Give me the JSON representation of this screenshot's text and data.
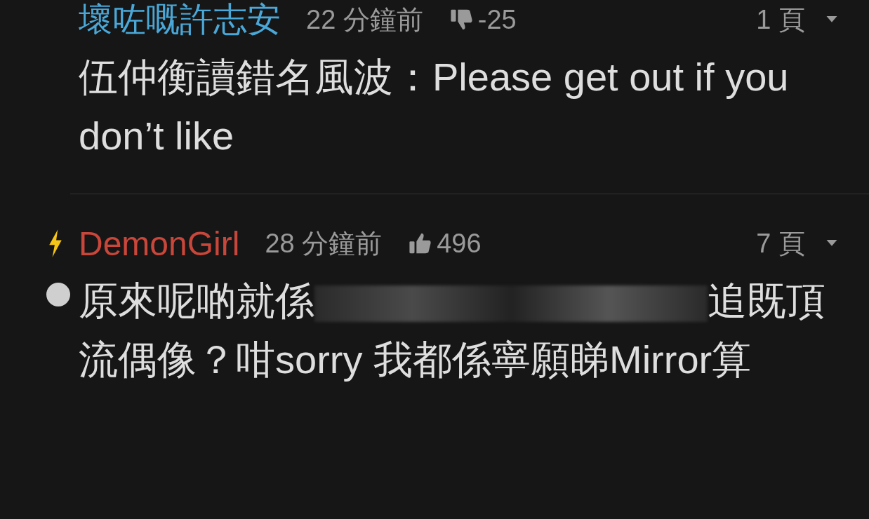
{
  "posts": [
    {
      "author": "壞咗嘅許志安",
      "color": "#4aa8d8",
      "time": "22 分鐘前",
      "vote": {
        "kind": "down",
        "score": "-25"
      },
      "page": "1 頁",
      "bullet": false,
      "body": [
        {
          "kind": "text",
          "text": "伍仲衡讀錯名風波：Please get out if you don’t like"
        }
      ]
    },
    {
      "author": "DemonGirl",
      "color": "#c8463a",
      "badge": {
        "kind": "bolt"
      },
      "time": "28 分鐘前",
      "vote": {
        "kind": "up",
        "score": "496"
      },
      "page": "7 頁",
      "bullet": true,
      "body": [
        {
          "kind": "text",
          "text": "原來呢啲就係"
        },
        {
          "kind": "redacted"
        },
        {
          "kind": "text",
          "text": "追既頂流偶像？咁sorry 我都係寧願睇Mirror算"
        }
      ]
    }
  ]
}
